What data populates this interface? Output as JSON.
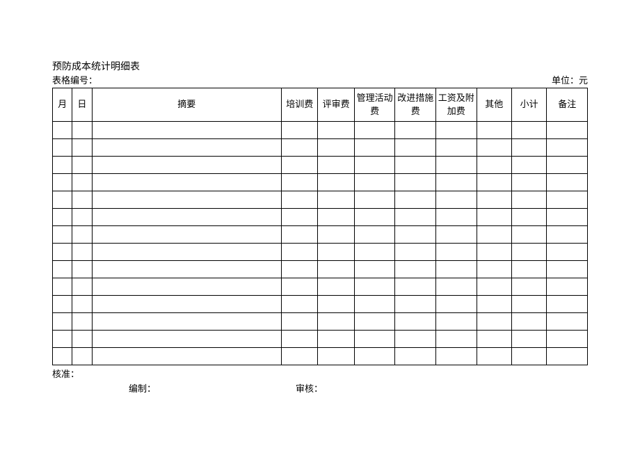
{
  "title": "预防成本统计明细表",
  "form_number_label": "表格编号：",
  "unit_label": "单位：元",
  "columns": {
    "month": "月",
    "day": "日",
    "summary": "摘要",
    "training_fee": "培训费",
    "review_fee": "评审费",
    "management_fee": "管理活动费",
    "improvement_fee": "改进措施费",
    "wage_fee": "工资及附加费",
    "other": "其他",
    "subtotal": "小计",
    "note": "备注"
  },
  "footer": {
    "approve": "核准：",
    "compile": "编制：",
    "audit": "审核："
  },
  "rows": [
    {},
    {},
    {},
    {},
    {},
    {},
    {},
    {},
    {},
    {},
    {},
    {},
    {},
    {}
  ]
}
